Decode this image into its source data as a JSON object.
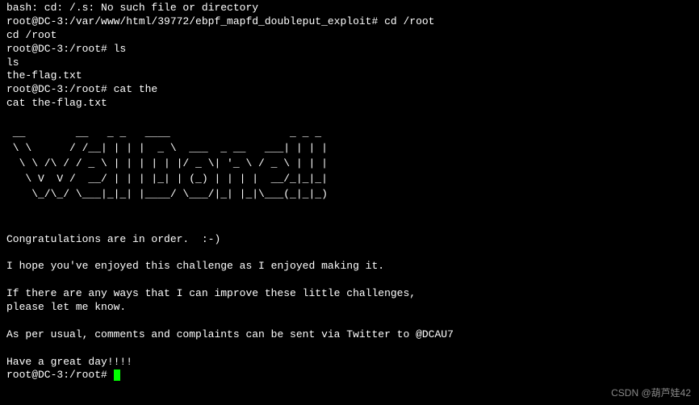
{
  "lines": {
    "l0": "bash: cd: /.s: No such file or directory",
    "l1": "root@DC-3:/var/www/html/39772/ebpf_mapfd_doubleput_exploit# cd /root",
    "l2": "cd /root",
    "l3": "root@DC-3:/root# ls",
    "l4": "ls",
    "l5": "the-flag.txt",
    "l6": "root@DC-3:/root# cat the",
    "l7": "cat the-flag.txt"
  },
  "ascii": {
    "a1": " __        __   _ _   ____                   _ _ _ ",
    "a2": " \\ \\      / /__| | | |  _ \\  ___  _ __   ___| | | |",
    "a3": "  \\ \\ /\\ / / _ \\ | | | | | |/ _ \\| '_ \\ / _ \\ | | |",
    "a4": "   \\ V  V /  __/ | | | |_| | (_) | | | |  __/_|_|_|",
    "a5": "    \\_/\\_/ \\___|_|_| |____/ \\___/|_| |_|\\___(_|_|_)",
    "a6": "                                                   "
  },
  "msg": {
    "m1": "Congratulations are in order.  :-)",
    "m2": "I hope you've enjoyed this challenge as I enjoyed making it.",
    "m3": "If there are any ways that I can improve these little challenges,",
    "m4": "please let me know.",
    "m5": "As per usual, comments and complaints can be sent via Twitter to @DCAU7",
    "m6": "Have a great day!!!!"
  },
  "final_prompt": "root@DC-3:/root# ",
  "watermark": "CSDN @葫芦娃42"
}
